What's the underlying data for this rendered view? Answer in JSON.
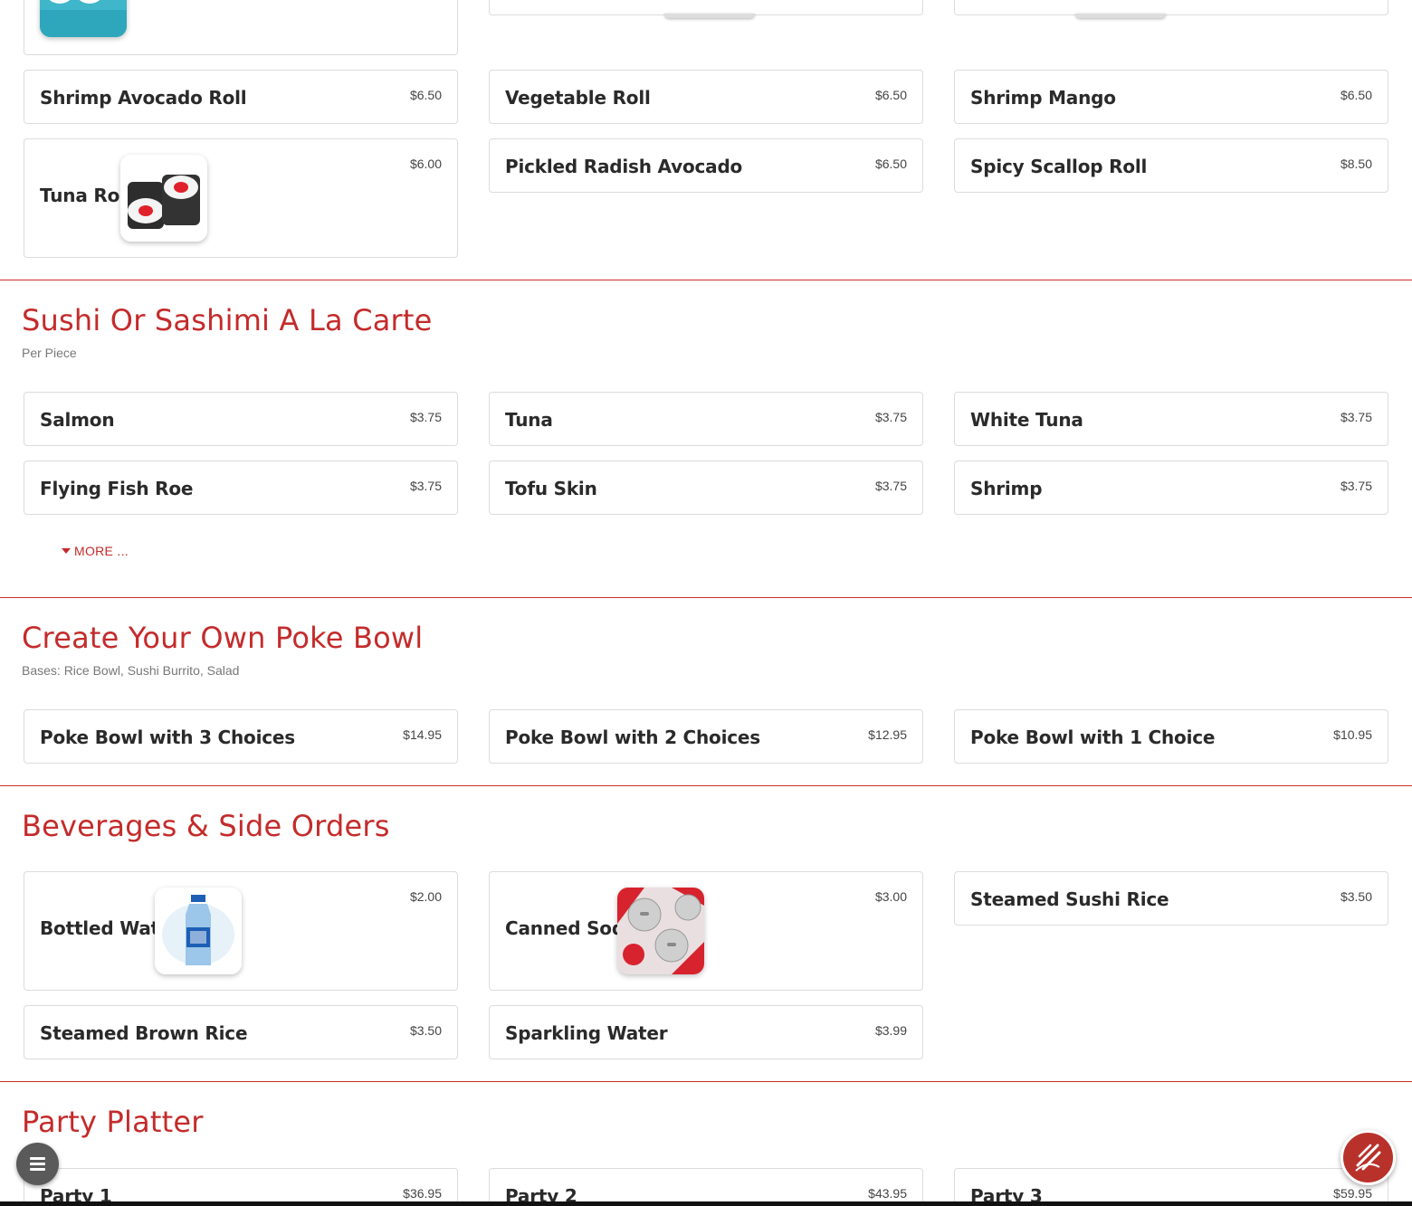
{
  "colors": {
    "accent": "#c42b2b",
    "divider": "#c9302c",
    "fab_order": "#b8322b",
    "fab_menu": "#5a5a5a"
  },
  "top_partial_row": [
    {
      "name": "",
      "price": "",
      "icon": "california-roll-image"
    },
    {
      "name": "",
      "price": ""
    },
    {
      "name": "",
      "price": ""
    }
  ],
  "rolls": [
    {
      "name": "Shrimp Avocado Roll",
      "price": "$6.50"
    },
    {
      "name": "Vegetable Roll",
      "price": "$6.50"
    },
    {
      "name": "Shrimp Mango",
      "price": "$6.50"
    },
    {
      "name": "Tuna Roll",
      "price": "$6.00",
      "icon": "tuna-roll-image"
    },
    {
      "name": "Pickled Radish Avocado",
      "price": "$6.50"
    },
    {
      "name": "Spicy Scallop Roll",
      "price": "$8.50"
    }
  ],
  "sushi_section": {
    "title": "Sushi Or Sashimi A La Carte",
    "description": "Per Piece",
    "items": [
      {
        "name": "Salmon",
        "price": "$3.75"
      },
      {
        "name": "Tuna",
        "price": "$3.75"
      },
      {
        "name": "White Tuna",
        "price": "$3.75"
      },
      {
        "name": "Flying Fish Roe",
        "price": "$3.75"
      },
      {
        "name": "Tofu Skin",
        "price": "$3.75"
      },
      {
        "name": "Shrimp",
        "price": "$3.75"
      }
    ],
    "more_label": "MORE ..."
  },
  "poke_section": {
    "title": "Create Your Own Poke Bowl",
    "description": "Bases: Rice Bowl, Sushi Burrito, Salad",
    "items": [
      {
        "name": "Poke Bowl with 3 Choices",
        "price": "$14.95"
      },
      {
        "name": "Poke Bowl with 2 Choices",
        "price": "$12.95"
      },
      {
        "name": "Poke Bowl with 1 Choice",
        "price": "$10.95"
      }
    ]
  },
  "beverage_section": {
    "title": "Beverages & Side Orders",
    "items": [
      {
        "name": "Bottled Water",
        "price": "$2.00",
        "icon": "bottled-water-image"
      },
      {
        "name": "Canned Soda",
        "price": "$3.00",
        "icon": "canned-soda-image"
      },
      {
        "name": "Steamed Sushi Rice",
        "price": "$3.50"
      },
      {
        "name": "Steamed Brown Rice",
        "price": "$3.50"
      },
      {
        "name": "Sparkling Water",
        "price": "$3.99"
      }
    ]
  },
  "party_section": {
    "title": "Party Platter",
    "items": [
      {
        "name": "Party 1",
        "price": "$36.95"
      },
      {
        "name": "Party 2",
        "price": "$43.95"
      },
      {
        "name": "Party 3",
        "price": "$59.95"
      }
    ]
  },
  "fabs": {
    "menu_icon": "hamburger-menu-icon",
    "order_icon": "order-online-icon"
  }
}
